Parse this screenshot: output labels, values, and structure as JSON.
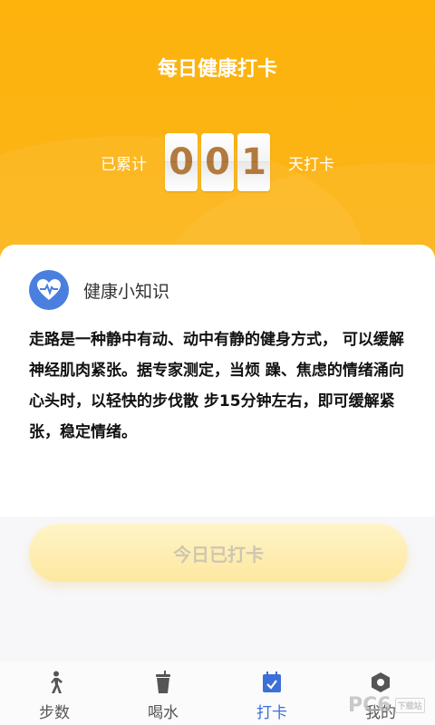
{
  "header": {
    "title": "每日健康打卡",
    "prefix": "已累计",
    "digits": [
      "0",
      "0",
      "1"
    ],
    "suffix": "天打卡"
  },
  "card": {
    "title": "健康小知识",
    "icon": "heart-pulse-icon",
    "body": "走路是一种静中有动、动中有静的健身方式， 可以缓解神经肌肉紧张。据专家测定，当烦 躁、焦虑的情绪涌向心头时，以轻快的步伐散 步15分钟左右，即可缓解紧张，稳定情绪。"
  },
  "checkin_button": {
    "label": "今日已打卡"
  },
  "tabs": [
    {
      "label": "步数",
      "icon": "walking-icon"
    },
    {
      "label": "喝水",
      "icon": "cup-icon"
    },
    {
      "label": "打卡",
      "icon": "calendar-check-icon",
      "active": true
    },
    {
      "label": "我的",
      "icon": "profile-icon"
    }
  ],
  "watermark": {
    "text": "PC6",
    "small": "下载站"
  },
  "colors": {
    "primary": "#fdb20c",
    "accent": "#3d6fd8",
    "digit": "#b27a3e"
  }
}
